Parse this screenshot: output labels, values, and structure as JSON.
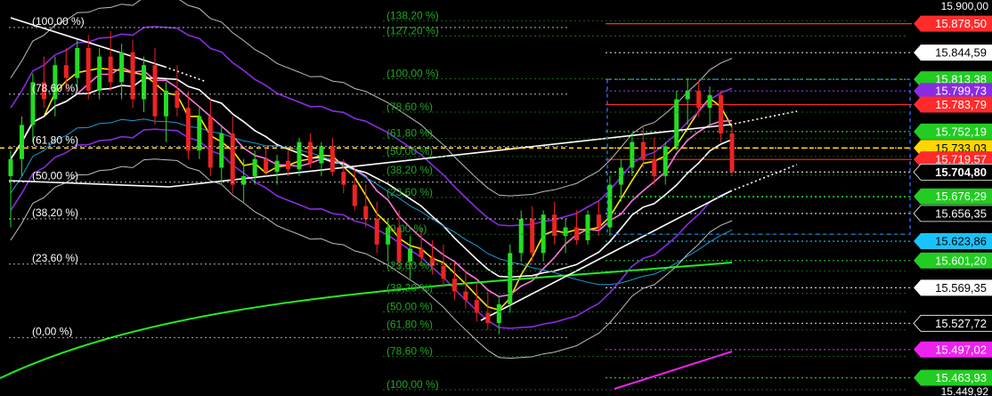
{
  "chart_data": {
    "type": "candlestick",
    "ylim": [
      15449.92,
      15900.0
    ],
    "axis_ticks": [
      "15.900,00",
      "15.449,92"
    ],
    "price_tags": [
      {
        "label": "15.878,50",
        "value": 15878.5,
        "bg": "#ff2b2b",
        "fg": "#ffffff"
      },
      {
        "label": "15.844,59",
        "value": 15844.59,
        "bg": "#ffffff",
        "fg": "#000000"
      },
      {
        "label": "15.813,38",
        "value": 15813.38,
        "bg": "#22cc22",
        "fg": "#ffffff"
      },
      {
        "label": "15.799,73",
        "value": 15799.73,
        "bg": "#8a2be2",
        "fg": "#ffffff"
      },
      {
        "label": "15.783,79",
        "value": 15783.79,
        "bg": "#ff2b2b",
        "fg": "#ffffff"
      },
      {
        "label": "15.752,19",
        "value": 15752.19,
        "bg": "#22cc22",
        "fg": "#ffffff"
      },
      {
        "label": "15.733,03",
        "value": 15733.03,
        "bg": "#ffd700",
        "fg": "#000000"
      },
      {
        "label": "15.719,57",
        "value": 15719.57,
        "bg": "#ff2b2b",
        "fg": "#ffffff"
      },
      {
        "label": "15.704,80",
        "value": 15704.8,
        "bg": "#000000",
        "fg": "#ffffff"
      },
      {
        "label": "15.676,29",
        "value": 15676.29,
        "bg": "#22cc22",
        "fg": "#ffffff"
      },
      {
        "label": "15.656,35",
        "value": 15656.35,
        "bg": "#000000",
        "fg": "#ffffff"
      },
      {
        "label": "15.623,86",
        "value": 15623.86,
        "bg": "#19c3ff",
        "fg": "#000000"
      },
      {
        "label": "15.601,20",
        "value": 15601.2,
        "bg": "#22cc22",
        "fg": "#ffffff"
      },
      {
        "label": "15.569,35",
        "value": 15569.35,
        "bg": "#ffffff",
        "fg": "#000000"
      },
      {
        "label": "15.527,72",
        "value": 15527.72,
        "bg": "#000000",
        "fg": "#ffffff"
      },
      {
        "label": "15.497,02",
        "value": 15497.02,
        "bg": "#ee22ee",
        "fg": "#ffffff"
      },
      {
        "label": "15.463,93",
        "value": 15463.93,
        "bg": "#22cc22",
        "fg": "#ffffff"
      }
    ],
    "fib_left": [
      {
        "label": "(100,00 %)",
        "value": 15874.0
      },
      {
        "label": "(78,60 %)",
        "value": 15796.0
      },
      {
        "label": "(61,80 %)",
        "value": 15735.0
      },
      {
        "label": "(50,00 %)",
        "value": 15693.0
      },
      {
        "label": "(38,20 %)",
        "value": 15650.0
      },
      {
        "label": "(23,60 %)",
        "value": 15597.0
      },
      {
        "label": "(0,00 %)",
        "value": 15511.0
      }
    ],
    "fib_right": [
      {
        "label": "(138,20 %)",
        "value": 15882.0
      },
      {
        "label": "(127,20 %)",
        "value": 15864.0
      },
      {
        "label": "(100,00 %)",
        "value": 15814.0
      },
      {
        "label": "(78,60 %)",
        "value": 15775.0
      },
      {
        "label": "(61,80 %)",
        "value": 15744.0
      },
      {
        "label": "(50,00 %)",
        "value": 15723.0
      },
      {
        "label": "(38,20 %)",
        "value": 15701.0
      },
      {
        "label": "(23,60 %)",
        "value": 15675.0
      },
      {
        "label": "(0,00 %)",
        "value": 15632.0
      },
      {
        "label": "(23,60 %)",
        "value": 15589.0
      },
      {
        "label": "(38,20 %)",
        "value": 15563.0
      },
      {
        "label": "(50,00 %)",
        "value": 15541.0
      },
      {
        "label": "(61,80 %)",
        "value": 15520.0
      },
      {
        "label": "(78,60 %)",
        "value": 15489.0
      },
      {
        "label": "(100,00 %)",
        "value": 15450.0
      },
      {
        "label": "(127,20 %)",
        "value": 15400.0
      }
    ],
    "candles": [
      [
        15700,
        15730,
        15640,
        15720
      ],
      [
        15720,
        15770,
        15700,
        15760
      ],
      [
        15760,
        15820,
        15740,
        15810
      ],
      [
        15810,
        15840,
        15780,
        15790
      ],
      [
        15790,
        15840,
        15770,
        15830
      ],
      [
        15830,
        15850,
        15800,
        15815
      ],
      [
        15815,
        15860,
        15805,
        15850
      ],
      [
        15850,
        15865,
        15790,
        15800
      ],
      [
        15800,
        15850,
        15790,
        15840
      ],
      [
        15840,
        15870,
        15800,
        15810
      ],
      [
        15810,
        15855,
        15790,
        15845
      ],
      [
        15845,
        15860,
        15780,
        15790
      ],
      [
        15790,
        15840,
        15775,
        15830
      ],
      [
        15830,
        15850,
        15760,
        15770
      ],
      [
        15770,
        15810,
        15740,
        15800
      ],
      [
        15800,
        15830,
        15770,
        15780
      ],
      [
        15780,
        15800,
        15720,
        15730
      ],
      [
        15730,
        15780,
        15720,
        15770
      ],
      [
        15770,
        15790,
        15700,
        15710
      ],
      [
        15710,
        15760,
        15690,
        15750
      ],
      [
        15750,
        15770,
        15680,
        15690
      ],
      [
        15690,
        15720,
        15670,
        15700
      ],
      [
        15700,
        15730,
        15690,
        15720
      ],
      [
        15720,
        15735,
        15700,
        15705
      ],
      [
        15705,
        15725,
        15690,
        15718
      ],
      [
        15718,
        15730,
        15700,
        15708
      ],
      [
        15708,
        15745,
        15700,
        15740
      ],
      [
        15740,
        15750,
        15710,
        15715
      ],
      [
        15715,
        15740,
        15700,
        15735
      ],
      [
        15735,
        15745,
        15700,
        15705
      ],
      [
        15705,
        15720,
        15680,
        15690
      ],
      [
        15690,
        15710,
        15660,
        15665
      ],
      [
        15665,
        15690,
        15640,
        15650
      ],
      [
        15650,
        15670,
        15610,
        15620
      ],
      [
        15620,
        15650,
        15600,
        15640
      ],
      [
        15640,
        15660,
        15590,
        15600
      ],
      [
        15600,
        15630,
        15580,
        15615
      ],
      [
        15615,
        15640,
        15595,
        15605
      ],
      [
        15605,
        15625,
        15585,
        15595
      ],
      [
        15595,
        15620,
        15570,
        15580
      ],
      [
        15580,
        15600,
        15555,
        15565
      ],
      [
        15565,
        15590,
        15545,
        15555
      ],
      [
        15555,
        15575,
        15530,
        15540
      ],
      [
        15540,
        15565,
        15520,
        15528
      ],
      [
        15528,
        15560,
        15515,
        15550
      ],
      [
        15550,
        15620,
        15540,
        15610
      ],
      [
        15610,
        15660,
        15600,
        15650
      ],
      [
        15650,
        15665,
        15600,
        15610
      ],
      [
        15610,
        15660,
        15600,
        15655
      ],
      [
        15655,
        15670,
        15620,
        15630
      ],
      [
        15630,
        15650,
        15610,
        15640
      ],
      [
        15640,
        15660,
        15620,
        15625
      ],
      [
        15625,
        15660,
        15620,
        15655
      ],
      [
        15655,
        15670,
        15630,
        15640
      ],
      [
        15640,
        15700,
        15630,
        15690
      ],
      [
        15690,
        15720,
        15670,
        15710
      ],
      [
        15710,
        15750,
        15700,
        15740
      ],
      [
        15740,
        15760,
        15710,
        15720
      ],
      [
        15720,
        15745,
        15690,
        15700
      ],
      [
        15700,
        15740,
        15690,
        15735
      ],
      [
        15735,
        15800,
        15730,
        15790
      ],
      [
        15790,
        15815,
        15760,
        15800
      ],
      [
        15800,
        15812,
        15770,
        15780
      ],
      [
        15780,
        15805,
        15760,
        15795
      ],
      [
        15795,
        15800,
        15740,
        15750
      ],
      [
        15750,
        15760,
        15700,
        15705
      ]
    ]
  }
}
